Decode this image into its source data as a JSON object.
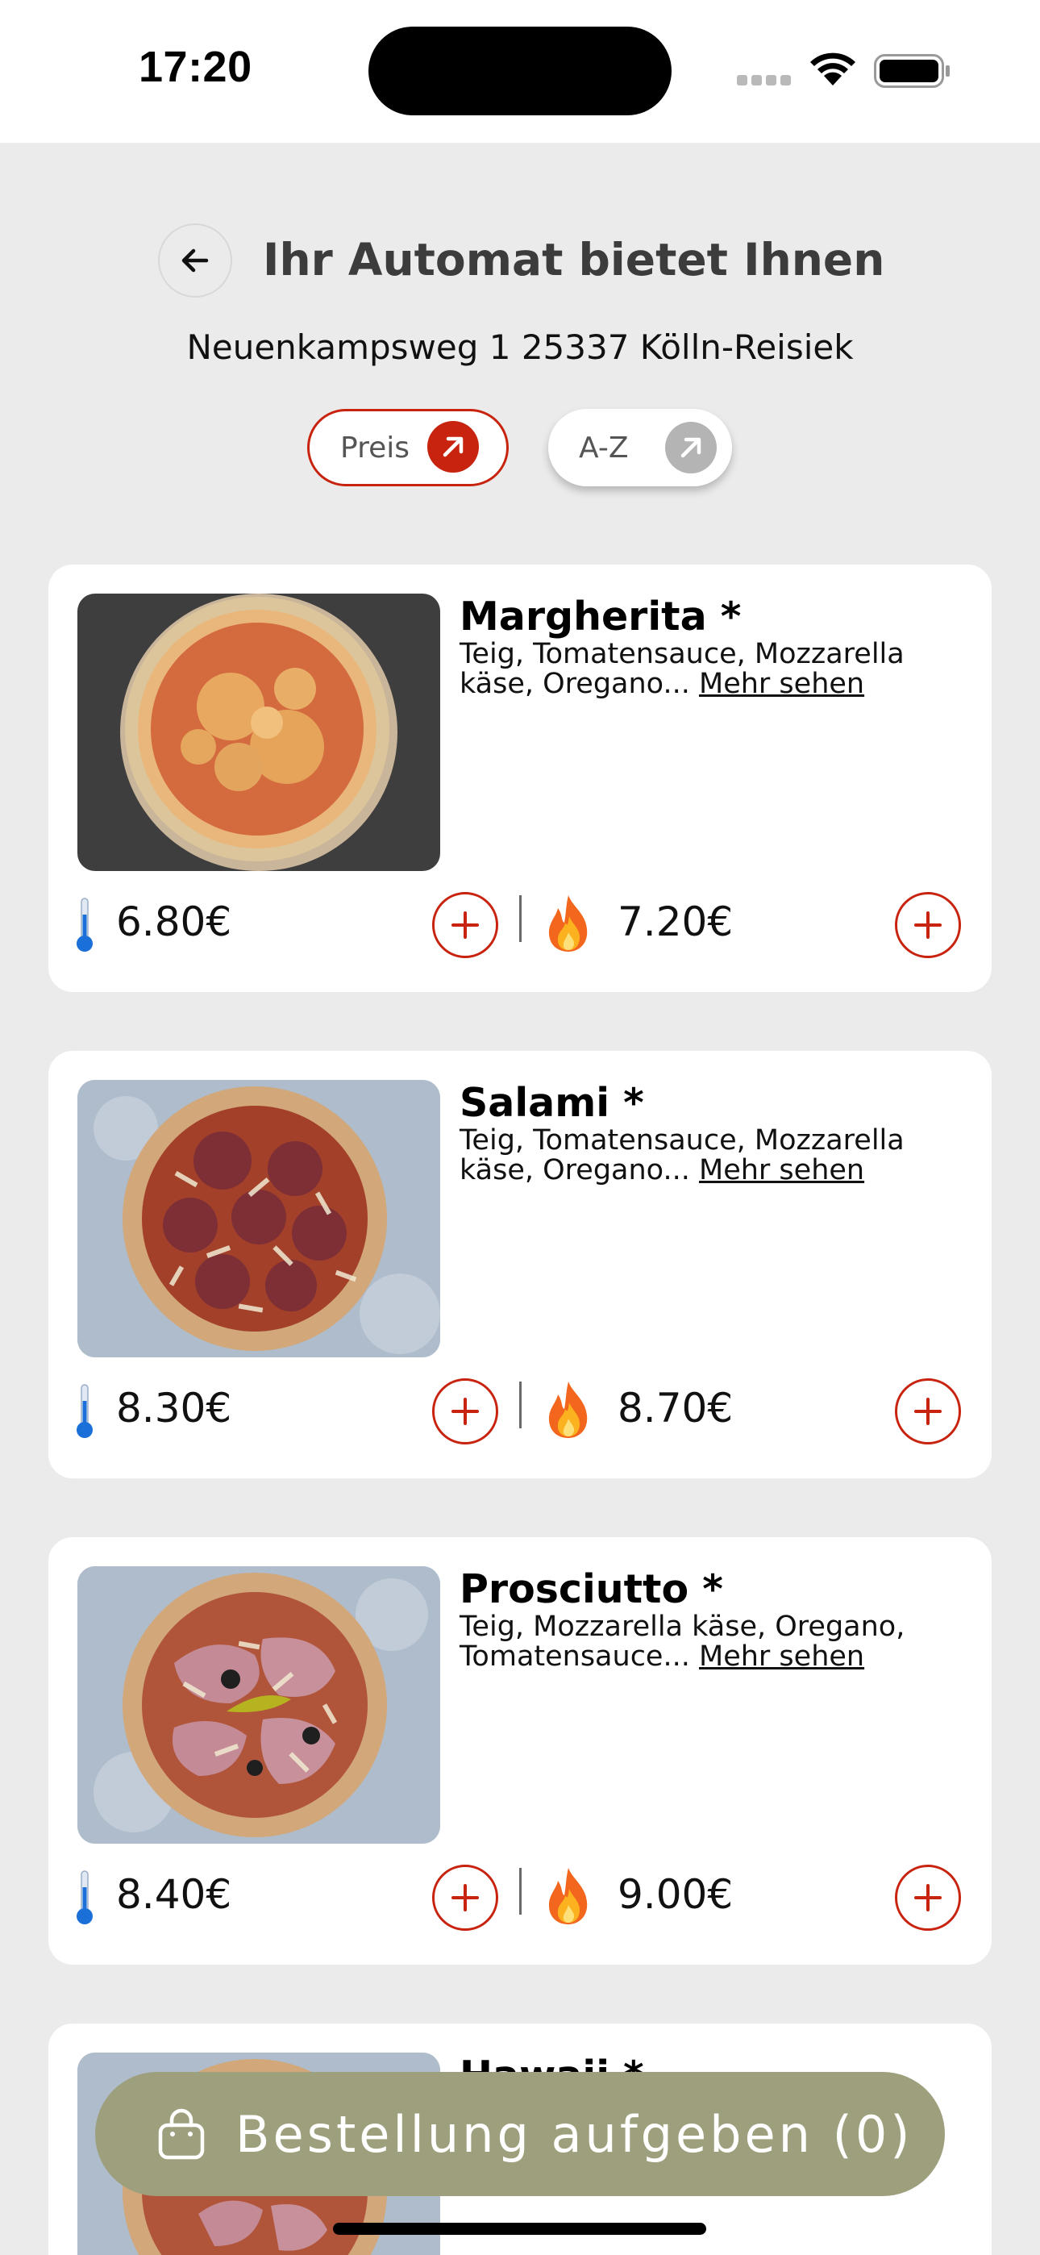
{
  "status_bar": {
    "time": "17:20"
  },
  "header": {
    "back_icon": "arrow-left-icon",
    "title": "Ihr Automat bietet Ihnen",
    "address": "Neuenkampsweg 1 25337 Kölln-Reisiek"
  },
  "sort": {
    "price_label": "Preis",
    "az_label": "A-Z",
    "active": "Preis"
  },
  "products": [
    {
      "name": "Margherita *",
      "description": "Teig, Tomatensauce, Mozzarella käse, Oregano...",
      "more_label": "Mehr sehen",
      "price_cold": "6.80€",
      "price_hot": "7.20€"
    },
    {
      "name": "Salami *",
      "description": "Teig, Tomatensauce, Mozzarella käse, Oregano...",
      "more_label": "Mehr sehen",
      "price_cold": "8.30€",
      "price_hot": "8.70€"
    },
    {
      "name": "Prosciutto *",
      "description": "Teig, Mozzarella käse, Oregano, Tomatensauce...",
      "more_label": "Mehr sehen",
      "price_cold": "8.40€",
      "price_hot": "9.00€"
    },
    {
      "name": "Hawaii *"
    }
  ],
  "order": {
    "label": "Bestellung aufgeben (0)",
    "icon": "shopping-bag-icon"
  },
  "colors": {
    "accent_red": "#c8230f",
    "order_button": "#9ea07d",
    "background": "#ebebeb",
    "card": "#ffffff"
  }
}
